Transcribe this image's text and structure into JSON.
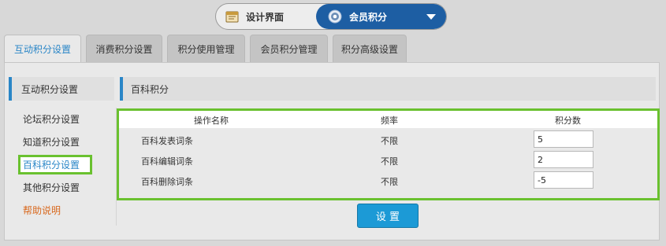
{
  "switcher": {
    "left_label": "设计界面",
    "right_label": "会员积分",
    "left_icon": "folder-icon",
    "right_icon": "gear-icon",
    "dropdown_icon": "caret-down-icon",
    "accent": "#1d5ea3"
  },
  "tabs": [
    {
      "label": "互动积分设置",
      "active": true
    },
    {
      "label": "消费积分设置",
      "active": false
    },
    {
      "label": "积分使用管理",
      "active": false
    },
    {
      "label": "会员积分管理",
      "active": false
    },
    {
      "label": "积分高级设置",
      "active": false
    }
  ],
  "sidebar": {
    "heading": "互动积分设置",
    "items": [
      {
        "label": "论坛积分设置"
      },
      {
        "label": "知道积分设置"
      },
      {
        "label": "百科积分设置"
      },
      {
        "label": "其他积分设置"
      },
      {
        "label": "帮助说明"
      }
    ]
  },
  "main": {
    "heading": "百科积分",
    "table": {
      "headers": [
        "操作名称",
        "频率",
        "积分数"
      ],
      "rows": [
        {
          "name": "百科发表词条",
          "freq": "不限",
          "points": "5"
        },
        {
          "name": "百科编辑词条",
          "freq": "不限",
          "points": "2"
        },
        {
          "name": "百科删除词条",
          "freq": "不限",
          "points": "-5"
        }
      ]
    },
    "submit_label": "设 置"
  },
  "colors": {
    "highlight_border": "#6ac12f",
    "link_blue": "#2a86c7",
    "help_orange": "#d9691e",
    "button_blue": "#1c9ad6"
  }
}
